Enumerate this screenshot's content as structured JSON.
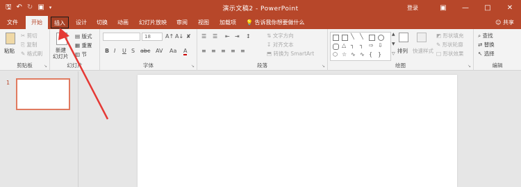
{
  "titlebar": {
    "doc_title": "演示文稿2 - PowerPoint",
    "login": "登录",
    "qat_icons": [
      "save-icon",
      "undo-icon",
      "redo-icon",
      "present-icon",
      "customize-icon"
    ]
  },
  "tabs": {
    "file": "文件",
    "home": "开始",
    "insert": "插入",
    "design": "设计",
    "transitions": "切换",
    "animations": "动画",
    "slideshow": "幻灯片放映",
    "review": "审阅",
    "view": "视图",
    "addins": "加载项",
    "tellme": "告诉我你想要做什么",
    "share": "共享"
  },
  "ribbon": {
    "clipboard": {
      "paste": "粘贴",
      "cut": "剪切",
      "copy": "复制",
      "format_painter": "格式刷",
      "label": "剪贴板"
    },
    "slides": {
      "new_slide": "新建",
      "new_slide2": "幻灯片",
      "layout": "版式",
      "reset": "重置",
      "section": "节",
      "label": "幻灯片"
    },
    "font": {
      "size": "18",
      "label": "字体",
      "bold": "B",
      "italic": "I",
      "underline": "U",
      "shadow": "S",
      "strike": "abc",
      "spacing": "AV",
      "case": "Aa",
      "color": "A"
    },
    "paragraph": {
      "text_direction": "文字方向",
      "align_text": "对齐文本",
      "smartart": "转换为 SmartArt",
      "label": "段落"
    },
    "drawing": {
      "arrange": "排列",
      "quick_styles": "快速样式",
      "fill": "形状填充",
      "outline": "形状轮廓",
      "effects": "形状效果",
      "label": "绘图"
    },
    "editing": {
      "find": "查找",
      "replace": "替换",
      "select": "选择",
      "label": "编辑"
    }
  },
  "slides_pane": {
    "slide_number": "1"
  },
  "colors": {
    "accent": "#b7472a",
    "thumb_border": "#e07a5f",
    "annotation": "#e53935"
  }
}
